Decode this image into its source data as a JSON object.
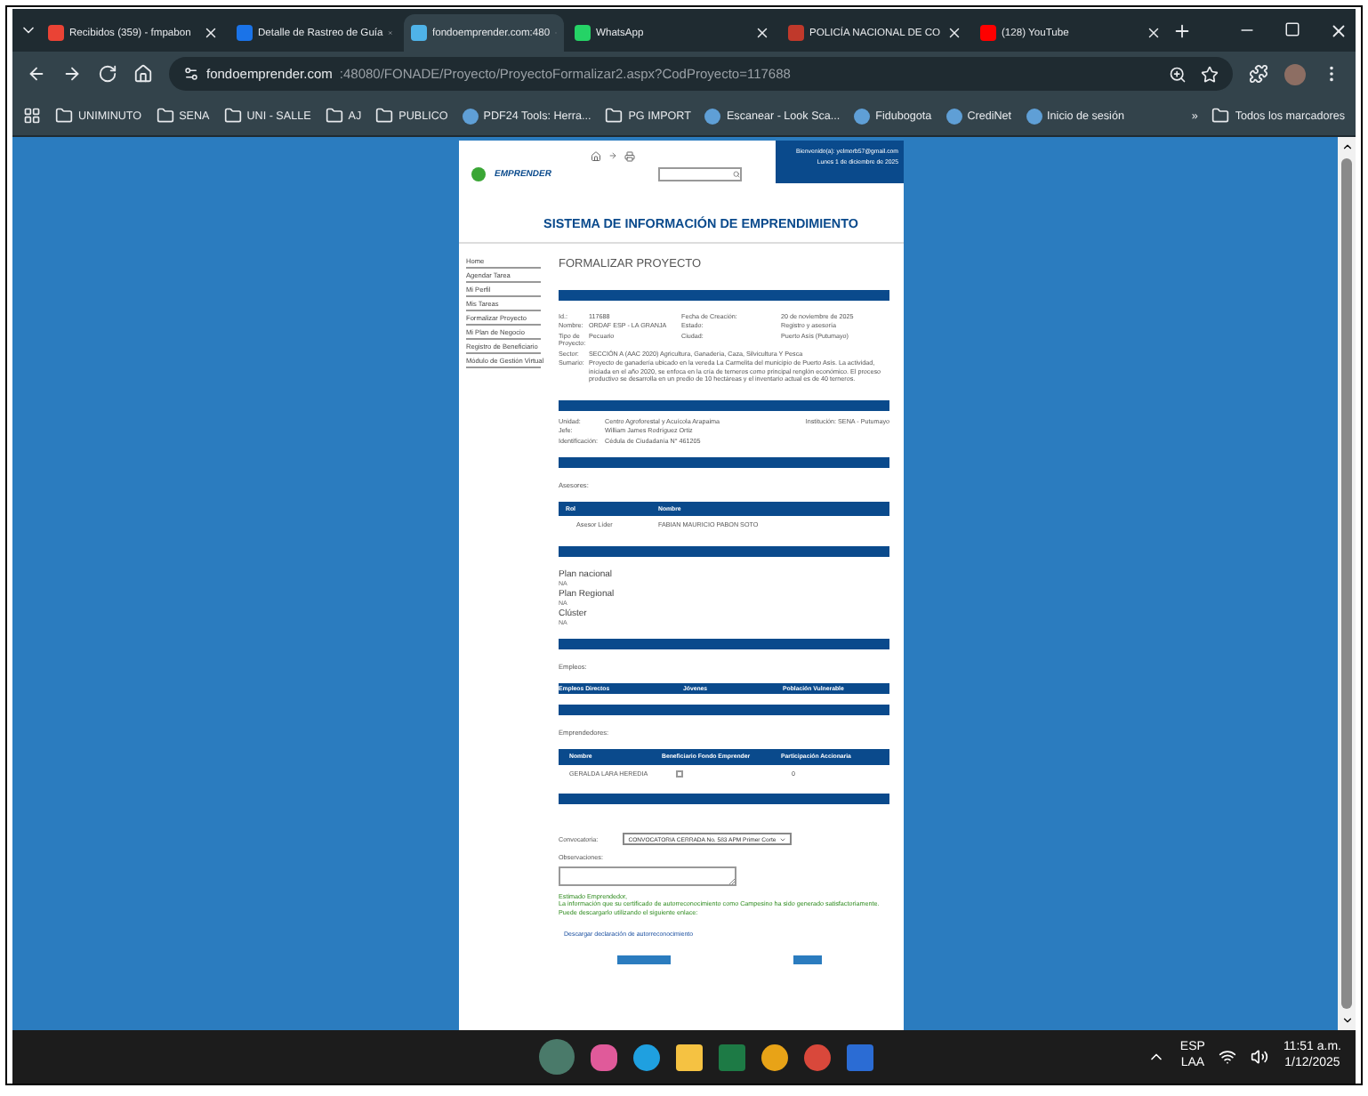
{
  "tabs": [
    {
      "title": "Recibidos (359) - fmpabon",
      "selected": false,
      "color": "#ea4335"
    },
    {
      "title": "Detalle de Rastreo de Guía",
      "selected": false,
      "color": "#1a73e8"
    },
    {
      "title": "fondoemprender.com:480",
      "selected": true,
      "color": "#4fb3e8"
    },
    {
      "title": "WhatsApp",
      "selected": false,
      "color": "#25d366"
    },
    {
      "title": "POLICÍA NACIONAL DE CO",
      "selected": false,
      "color": "#c0392b"
    },
    {
      "title": "(128) YouTube",
      "selected": false,
      "color": "#ff0000"
    }
  ],
  "address": {
    "host": "fondoemprender.com",
    "path": ":48080/FONADE/Proyecto/ProyectoFormalizar2.aspx?CodProyecto=117688"
  },
  "bookmarks": [
    {
      "label": "UNIMINUTO",
      "kind": "folder"
    },
    {
      "label": "SENA",
      "kind": "folder"
    },
    {
      "label": "UNI - SALLE",
      "kind": "folder"
    },
    {
      "label": "AJ",
      "kind": "folder"
    },
    {
      "label": "PUBLICO",
      "kind": "folder"
    },
    {
      "label": "PDF24 Tools: Herra...",
      "kind": "site"
    },
    {
      "label": "PG IMPORT",
      "kind": "folder"
    },
    {
      "label": "Escanear - Look Sca...",
      "kind": "site"
    },
    {
      "label": "Fidubogota",
      "kind": "site"
    },
    {
      "label": "CrediNet",
      "kind": "site"
    },
    {
      "label": "Inicio de sesión",
      "kind": "site"
    }
  ],
  "bookmarks_more": "»",
  "all_bookmarks": "Todos los marcadores",
  "page": {
    "brand": "EMPRENDER",
    "welcome": "Bienvenido(a): yelmorb57@gmail.com",
    "date": "Lunes 1 de diciembre de 2025",
    "title": "SISTEMA DE INFORMACIÓN DE EMPRENDIMIENTO",
    "menu": [
      "Home",
      "Agendar Tarea",
      "Mi Perfil",
      "Mis Tareas",
      "Formalizar Proyecto",
      "Mi Plan de Negocio",
      "Registro de Beneficiario",
      "Módulo de Gestión Virtual"
    ],
    "heading": "FORMALIZAR PROYECTO",
    "info": [
      [
        "Id.:",
        "117688",
        "Fecha de Creación:",
        "20 de noviembre de 2025"
      ],
      [
        "Nombre:",
        "ORDAF ESP - LA GRANJA",
        "Estado:",
        "Registro y asesoría"
      ],
      [
        "Tipo de Proyecto:",
        "Pecuario",
        "Ciudad:",
        "Puerto Asís (Putumayo)"
      ]
    ],
    "sector": [
      "Sector:",
      "SECCIÓN A (AAC 2020) Agricultura, Ganadería, Caza, Silvicultura Y Pesca"
    ],
    "summary": [
      "Sumario:",
      "Proyecto de ganadería ubicado en la vereda La Carmelita del municipio de Puerto Asís. La actividad, iniciada en el año 2020, se enfoca en la cría de terneros como principal renglón económico. El proceso productivo se desarrolla en un predio de 10 hectáreas y el inventario actual es de 40 terneros."
    ],
    "unit": [
      [
        "Unidad:",
        "Centro Agroforestal y Acuícola Arapaima"
      ],
      [
        "Jefe:",
        "William James Rodríguez Ortiz"
      ],
      [
        "Identificación:",
        "Cédula de Ciudadanía N° 461205"
      ]
    ],
    "institution": "Institución: SENA - Putumayo",
    "advisors_label": "Asesores:",
    "advisors_columns": [
      "Rol",
      "Nombre"
    ],
    "advisors_rows": [
      [
        "Asesor Líder",
        "FABIAN MAURICIO PABON SOTO"
      ]
    ],
    "plans": [
      [
        "Plan nacional",
        "NA"
      ],
      [
        "Plan Regional",
        "NA"
      ],
      [
        "Clúster",
        "NA"
      ]
    ],
    "jobs_label": "Empleos:",
    "jobs_columns": [
      "Empleos Directos",
      "Jóvenes",
      "Población Vulnerable"
    ],
    "entrepreneurs_label": "Emprendedores:",
    "entrepreneurs_columns": [
      "Nombre",
      "Beneficiario Fondo Emprender",
      "Participación Accionaria"
    ],
    "entrepreneurs_rows": [
      {
        "name": "GERALDA LARA HEREDIA",
        "beneficiary": false,
        "share": "0"
      }
    ],
    "call_label": "Convocatoria:",
    "call_value": "CONVOCATORIA CERRADA No. 583 APM Primer Corte",
    "notes_label": "Observaciones:",
    "notice_title": "Estimado Emprendedor,",
    "notice_text": "La información que su certificado de autorreconocimiento como Campesino ha sido generado satisfactoriamente. Puede descargarlo utilizando el siguiente enlace:",
    "download_link": "Descargar declaración de autorreconocimiento"
  },
  "taskbar": {
    "lang": "ESP",
    "layout": "LAA",
    "time": "11:51 a.m.",
    "date": "1/12/2025"
  }
}
